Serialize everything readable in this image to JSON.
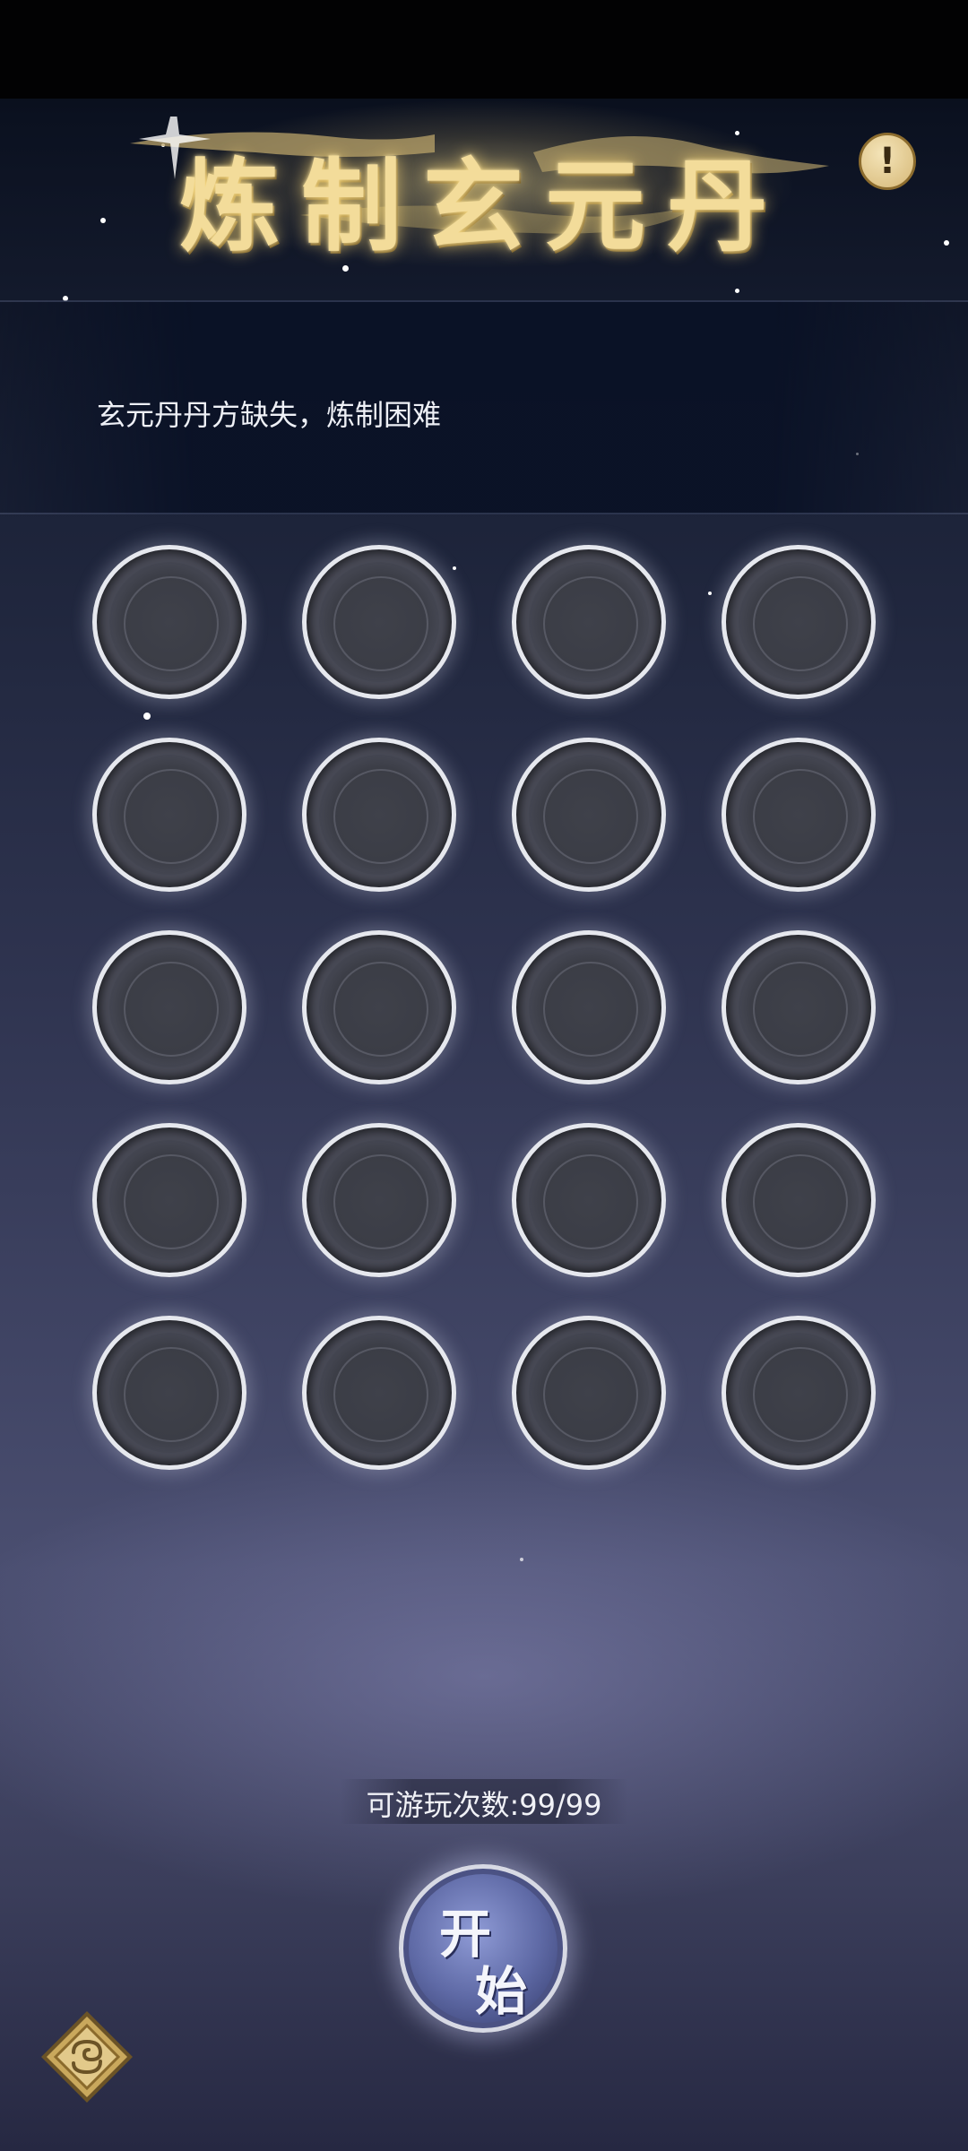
{
  "title": "炼制玄元丹",
  "info_button": {
    "icon": "exclamation-icon",
    "glyph": "!"
  },
  "description": "玄元丹丹方缺失，炼制困难",
  "slot_grid": {
    "rows": 5,
    "columns": 4
  },
  "plays_remaining": "可游玩次数:99/99",
  "start_button": {
    "char1": "开",
    "char2": "始"
  },
  "back_button": {
    "icon": "diamond-swirl-icon"
  },
  "colors": {
    "title_gold": "#f3dc9a",
    "slot_ring": "#e6e8ee",
    "start_blue": "#5f6aa6",
    "back_gold": "#c9a85c"
  }
}
